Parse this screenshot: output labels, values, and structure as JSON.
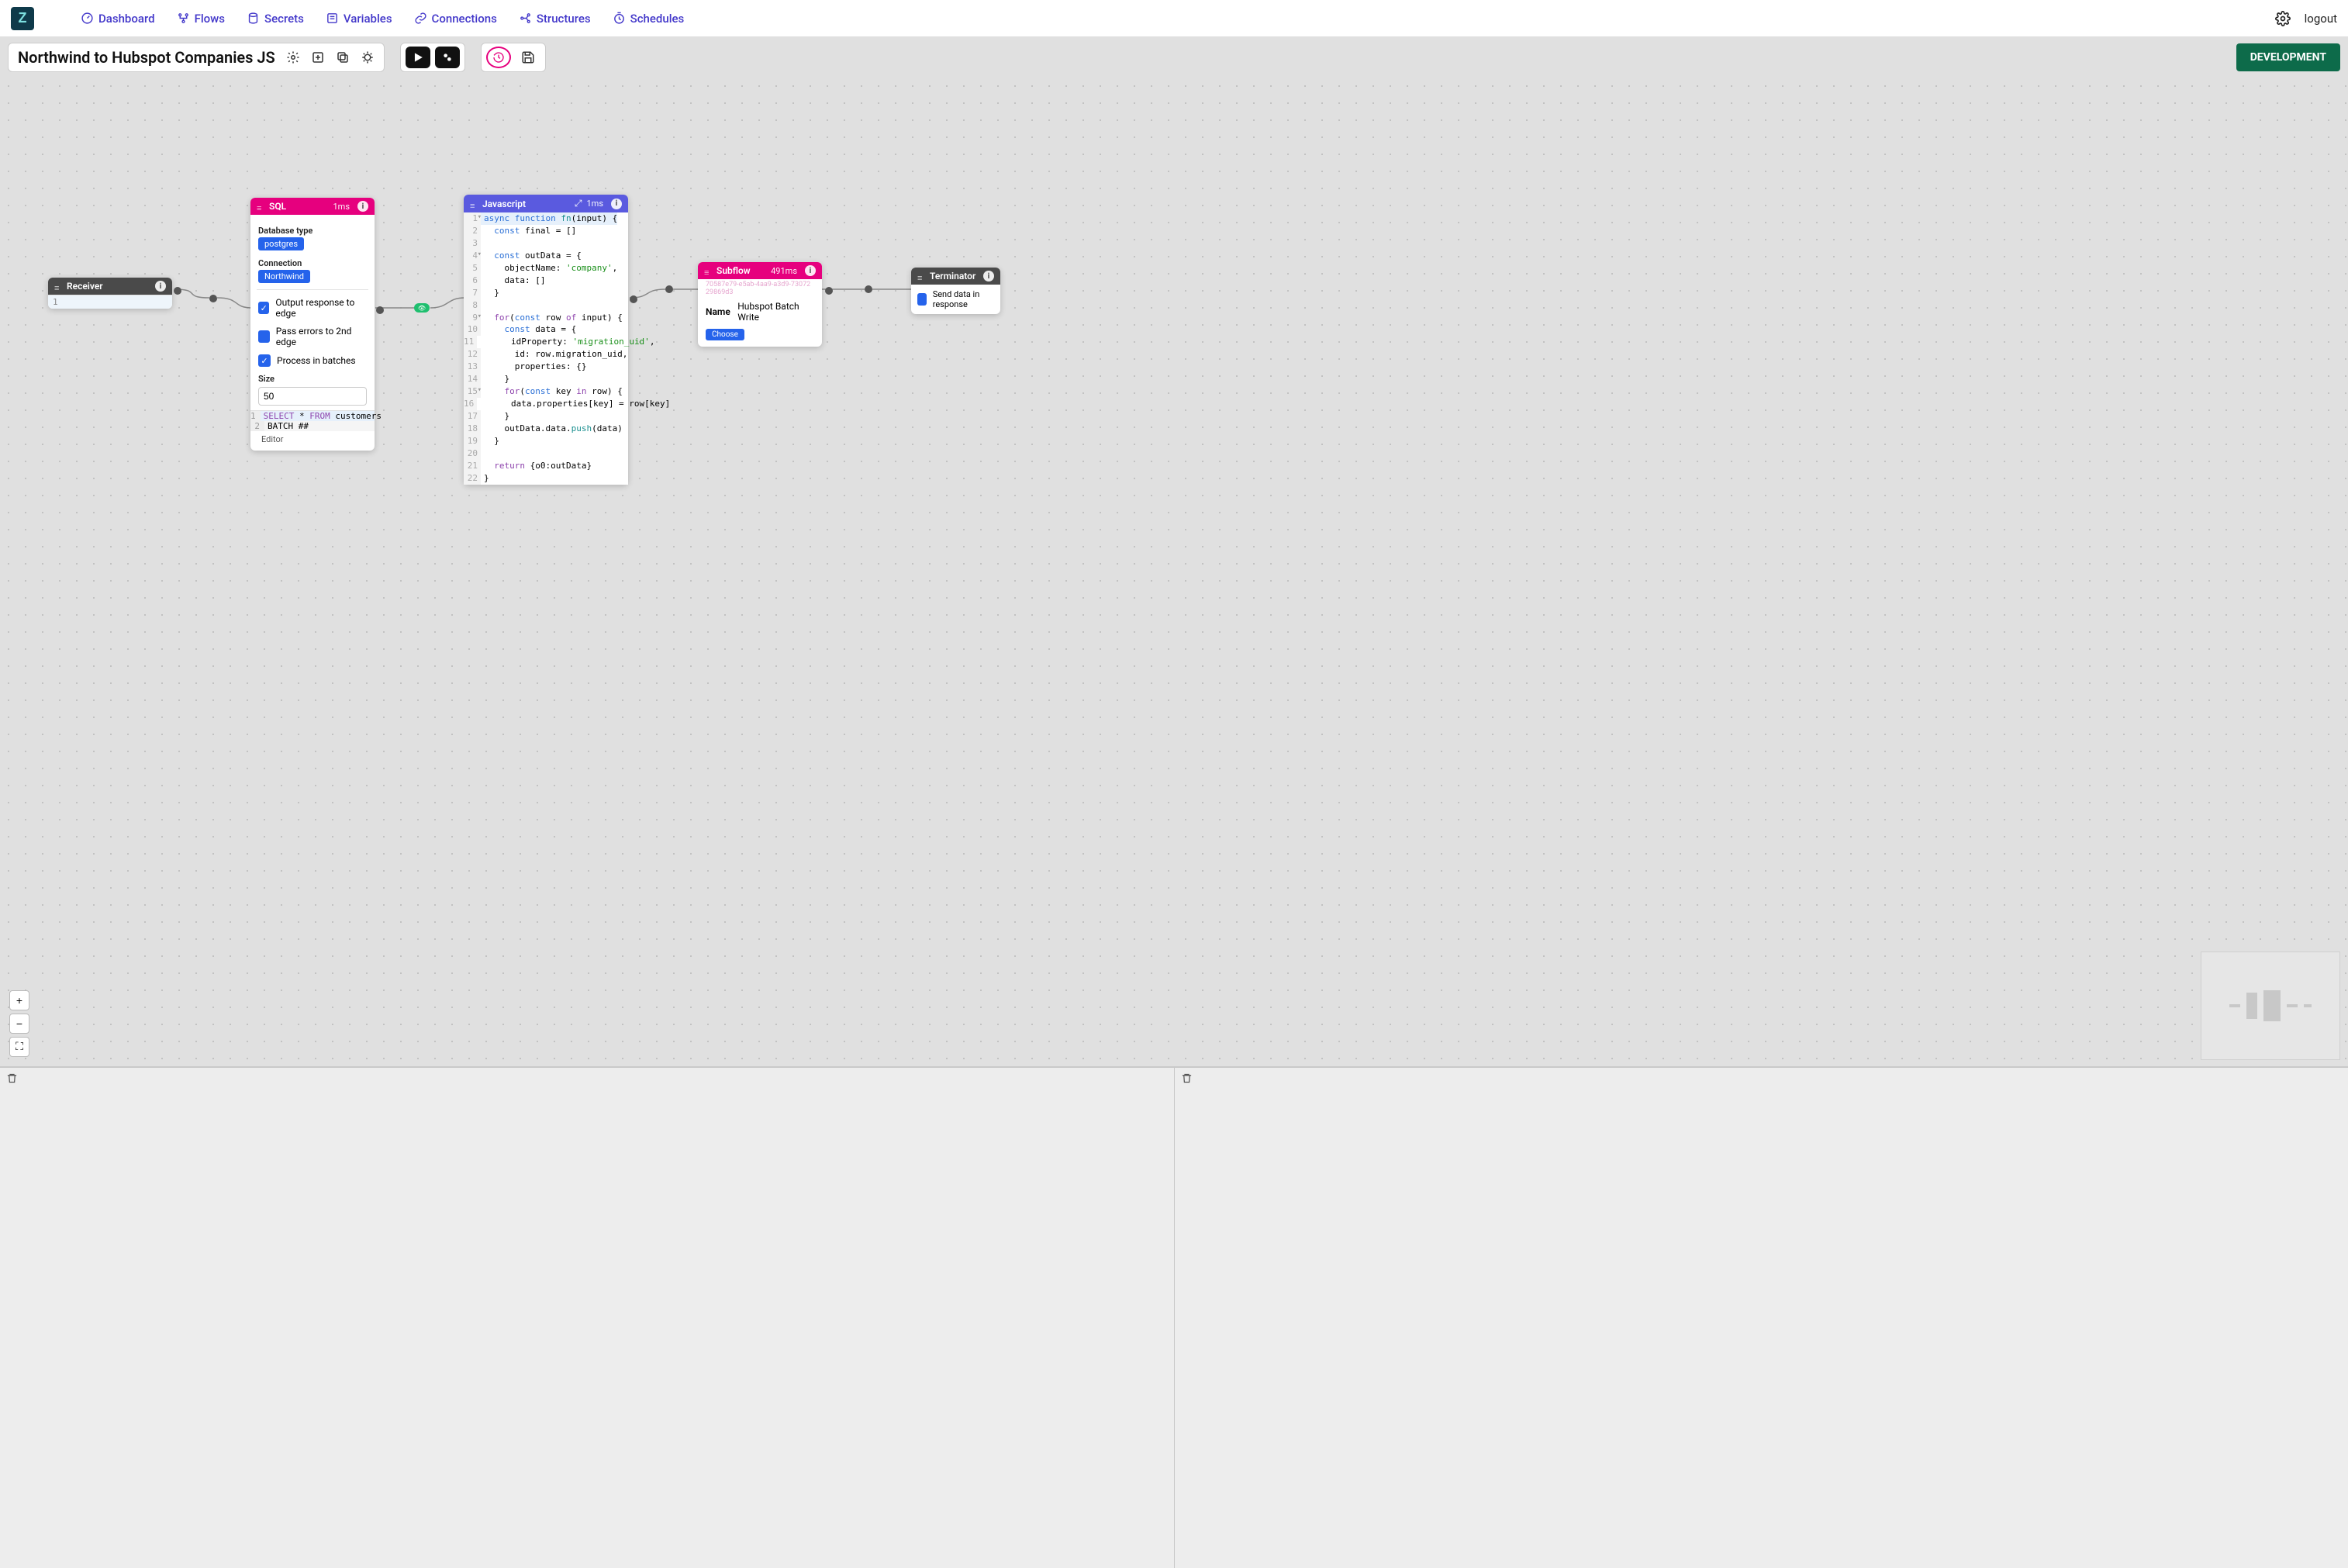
{
  "nav": {
    "dashboard": "Dashboard",
    "flows": "Flows",
    "secrets": "Secrets",
    "variables": "Variables",
    "connections": "Connections",
    "structures": "Structures",
    "schedules": "Schedules",
    "logout": "logout"
  },
  "toolbar": {
    "title": "Northwind to Hubspot Companies JS",
    "dev_button": "DEVELOPMENT"
  },
  "nodes": {
    "receiver": {
      "title": "Receiver",
      "line1": "1"
    },
    "sql": {
      "title": "SQL",
      "time": "1ms",
      "db_type_label": "Database type",
      "db_type_value": "postgres",
      "connection_label": "Connection",
      "connection_value": "Northwind",
      "chk_output": "Output response to edge",
      "chk_errors": "Pass errors to 2nd edge",
      "chk_batches": "Process in batches",
      "size_label": "Size",
      "size_value": "50",
      "code": {
        "l1_kw": "SELECT",
        "l1_rest": " * ",
        "l1_kw2": "FROM",
        "l1_rest2": " customers",
        "l2": "BATCH ##"
      },
      "editor_link": "Editor"
    },
    "js": {
      "title": "Javascript",
      "time": "1ms",
      "lines": {
        "l1": "async function fn(input) {",
        "l2": "  const final = []",
        "l3": "",
        "l4": "  const outData = {",
        "l5": "    objectName: 'company',",
        "l6": "    data: []",
        "l7": "  }",
        "l8": "",
        "l9": "  for(const row of input) {",
        "l10": "    const data = {",
        "l11": "      idProperty: 'migration_uid',",
        "l12": "      id: row.migration_uid,",
        "l13": "      properties: {}",
        "l14": "    }",
        "l15": "    for(const key in row) {",
        "l16": "      data.properties[key] = row[key]",
        "l17": "    }",
        "l18": "    outData.data.push(data)",
        "l19": "  }",
        "l20": "",
        "l21": "  return {o0:outData}",
        "l22": "}"
      }
    },
    "subflow": {
      "title": "Subflow",
      "time": "491ms",
      "uuid": "70587e79-e5ab-4aa9-a3d9-7307229869d3",
      "name_label": "Name",
      "name_value": "Hubspot Batch Write",
      "choose": "Choose"
    },
    "terminator": {
      "title": "Terminator",
      "chk_send": "Send data in response"
    }
  }
}
